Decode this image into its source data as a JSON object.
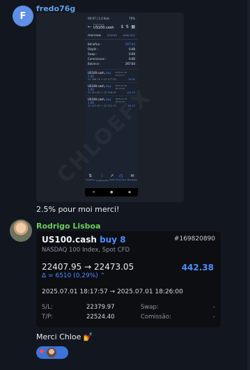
{
  "messages": [
    {
      "avatar_letter": "F",
      "sender": "fredo76g",
      "screenshot": {
        "status_left": "09:07 | 1,0 Ko/s",
        "status_right": "79%",
        "subtitle": "Historique",
        "title": "US100.cash",
        "tabs": [
          {
            "label": "POSITIONS",
            "active": true
          },
          {
            "label": "ORDRES",
            "active": false
          },
          {
            "label": "MARCHÉS",
            "active": false
          }
        ],
        "summary": [
          {
            "label": "Bénéfice :",
            "value": "267.64",
            "accent": true
          },
          {
            "label": "Dépôt :",
            "value": "0.00",
            "accent": false
          },
          {
            "label": "Swap :",
            "value": "0.00",
            "accent": false
          },
          {
            "label": "Commission :",
            "value": "0.00",
            "accent": false
          },
          {
            "label": "Balance :",
            "value": "267.64",
            "accent": false
          }
        ],
        "deals": [
          {
            "symbol": "US100.cash,",
            "side": "buy 1.00",
            "date": "2025.07.01 18:09:27",
            "prices": "22 398.15 → 22 477.05",
            "profit": "78.90"
          },
          {
            "symbol": "US100.cash,",
            "side": "buy 1.00",
            "date": "2025.07.01 18:14:48",
            "prices": "22 411.80 → 22 516.09",
            "profit": "104.29"
          },
          {
            "symbol": "US100.cash,",
            "side": "buy 1.00",
            "date": "2025.07.01 18:23:14",
            "prices": "22 427.95 → 22 512.15",
            "profit": "84.20"
          }
        ],
        "nav": [
          {
            "label": "Cotations",
            "icon": "⇅",
            "active": false
          },
          {
            "label": "Graphiques",
            "icon": "⫶",
            "active": false
          },
          {
            "label": "Trade",
            "icon": "↗",
            "active": false
          },
          {
            "label": "Historique",
            "icon": "◷",
            "active": true
          },
          {
            "label": "Messages",
            "icon": "✉",
            "active": false
          }
        ],
        "watermark": "CHLOEFX"
      },
      "text": "2.5% pour moi merci!"
    },
    {
      "sender": "Rodrigo Lisboa",
      "trade": {
        "symbol": "US100.cash",
        "side": "buy 8",
        "ticket": "#169820890",
        "description": "NASDAQ 100 Index, Spot CFD",
        "prices": "22407.95 → 22473.05",
        "profit": "442.38",
        "delta": "Δ = 6510 (0.29%) ⌃",
        "time": "2025.07.01 18:17:57 → 2025.07.01 18:26:00",
        "sl_label": "S/L:",
        "sl_value": "22379.97",
        "tp_label": "T/P:",
        "tp_value": "22524.40",
        "swap_label": "Swap:",
        "swap_value": "-",
        "commission_label": "Comissão:",
        "commission_value": "-"
      },
      "text": "Merci Chloe 💅",
      "reaction": "♥"
    }
  ],
  "colors": {
    "background": "#12171f",
    "accent_blue": "#4f8cff",
    "sender_green": "#6ccd5a",
    "sender_blue": "#5fa3ea"
  }
}
